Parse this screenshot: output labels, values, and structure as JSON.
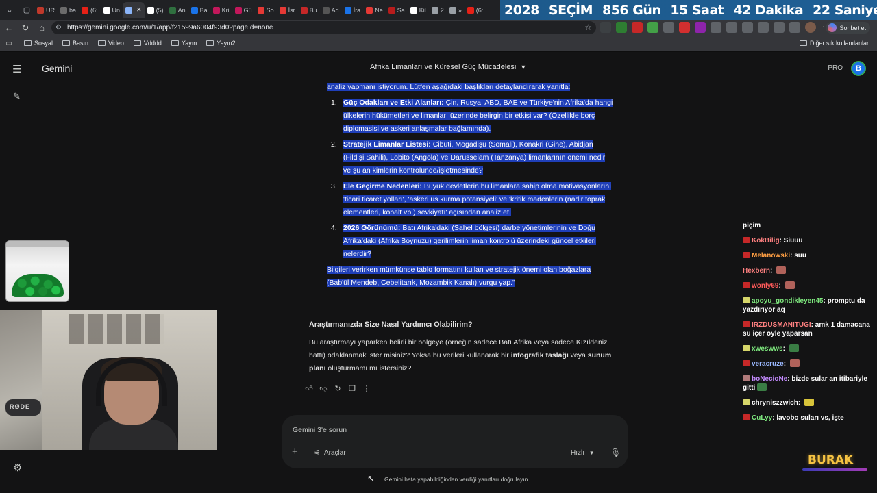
{
  "tabs": [
    {
      "label": "UR",
      "color": "#c0392b"
    },
    {
      "label": "ba",
      "color": "#6b6b6b"
    },
    {
      "label": "(6:",
      "color": "#e62117"
    },
    {
      "label": "Un",
      "color": "#ffffff"
    },
    {
      "label": "",
      "color": "#8ab4f8",
      "active": true
    },
    {
      "label": "(5)",
      "color": "#ffffff"
    },
    {
      "label": "An",
      "color": "#2f6f3f"
    },
    {
      "label": "Ba",
      "color": "#1a73e8"
    },
    {
      "label": "Kri",
      "color": "#c2185b"
    },
    {
      "label": "Gü",
      "color": "#c2185b"
    },
    {
      "label": "So",
      "color": "#e53935"
    },
    {
      "label": "İsr",
      "color": "#e53935"
    },
    {
      "label": "Bu",
      "color": "#c62828"
    },
    {
      "label": "Ad",
      "color": "#555555"
    },
    {
      "label": "İra",
      "color": "#1a73e8"
    },
    {
      "label": "Ne",
      "color": "#e53935"
    },
    {
      "label": "Sa",
      "color": "#b71c1c"
    },
    {
      "label": "Kil",
      "color": "#ffffff"
    },
    {
      "label": "2",
      "color": "#9aa0a6"
    },
    {
      "label": "»",
      "color": "#9aa0a6"
    },
    {
      "label": "(6:",
      "color": "#e62117"
    }
  ],
  "countdown": {
    "year": "2028",
    "label": "SEÇİM",
    "days": "856 Gün",
    "hours": "15 Saat",
    "minutes": "42 Dakika",
    "seconds": "22 Saniye"
  },
  "address": {
    "url": "https://gemini.google.com/u/1/app/f21599a6004f93d0?pageId=none",
    "sohbet_label": "Sohbet et"
  },
  "bookmarks": {
    "items": [
      "Sosyal",
      "Basın",
      "Video",
      "Vdddd",
      "Yayın",
      "Yayın2"
    ],
    "other": "Diğer sık kullanılanlar"
  },
  "header": {
    "brand": "Gemini",
    "conversation_title": "Afrika Limanları ve Küresel Güç Mücadelesi",
    "pro": "PRO",
    "avatar_letter": "B"
  },
  "prompt": {
    "intro": "analiz yapmanı istiyorum. Lütfen aşağıdaki başlıkları detaylandırarak yanıtla:",
    "items": [
      {
        "num": "1.",
        "title": "Güç Odakları ve Etki Alanları:",
        "text": " Çin, Rusya, ABD, BAE ve Türkiye'nin Afrika'da hangi ülkelerin hükümetleri ve limanları üzerinde belirgin bir etkisi var? (Özellikle borç diplomasisi ve askeri anlaşmalar bağlamında)."
      },
      {
        "num": "2.",
        "title": "Stratejik Limanlar Listesi:",
        "text": " Cibuti, Mogadişu (Somali), Konakri (Gine), Abidjan (Fildişi Sahili), Lobito (Angola) ve Darüsselam (Tanzanya) limanlarının önemi nedir ve şu an kimlerin kontrolünde/işletmesinde?"
      },
      {
        "num": "3.",
        "title": "Ele Geçirme Nedenleri:",
        "text": " Büyük devletlerin bu limanlara sahip olma motivasyonlarını 'ticari ticaret yolları', 'askeri üs kurma potansiyeli' ve 'kritik madenlerin (nadir toprak elementleri, kobalt vb.) sevkiyatı' açısından analiz et."
      },
      {
        "num": "4.",
        "title": "2026 Görünümü:",
        "text": " Batı Afrika'daki (Sahel bölgesi) darbe yönetimlerinin ve Doğu Afrika'daki (Afrika Boynuzu) gerilimlerin liman kontrolü üzerindeki güncel etkileri nelerdir?"
      }
    ],
    "outro": "Bilgileri verirken mümkünse tablo formatını kullan ve stratejik önemi olan boğazlara (Bab'ül Mendeb, Cebelitarık, Mozambik Kanalı) vurgu yap.\""
  },
  "response": {
    "heading": "Araştırmanızda Size Nasıl Yardımcı Olabilirim?",
    "text_1": "Bu araştırmayı yaparken belirli bir bölgeye (örneğin sadece Batı Afrika veya sadece Kızıldeniz hattı) odaklanmak ister misiniz? Yoksa bu verileri kullanarak bir ",
    "bold_1": "infografik taslağı",
    "text_2": " veya ",
    "bold_2": "sunum planı",
    "text_3": " oluşturmamı mı istersiniz?"
  },
  "input": {
    "placeholder": "Gemini 3'e sorun",
    "tools_label": "Araçlar",
    "speed_label": "Hızlı",
    "disclaimer": "Gemini hata yapabildiğinden verdiği yanıtları doğrulayın."
  },
  "chat": {
    "header": "piçim",
    "messages": [
      {
        "user": "KokBilig",
        "color": "#ff8080",
        "text": "Siuuu",
        "badge": "#c62828"
      },
      {
        "user": "Melanowski",
        "color": "#ff9f43",
        "text": "suu",
        "badge": "#c62828"
      },
      {
        "user": "Hexbern",
        "color": "#ff8080",
        "text": "",
        "badge": "",
        "emote": "#b0625a"
      },
      {
        "user": "wonly69",
        "color": "#ff5a5a",
        "text": "",
        "badge": "#c62828",
        "emote": "#b0625a"
      },
      {
        "user": "apoyu_gondikleyen45",
        "color": "#7ee87e",
        "text": "promptu da yazdırıyor aq",
        "badge": "#d6d66a"
      },
      {
        "user": "IRZDUSMANITUGI",
        "color": "#ff8080",
        "text": "amk 1 damacana su içer öyle yaparsan",
        "badge": "#c62828"
      },
      {
        "user": "xweswws",
        "color": "#7ee87e",
        "text": "",
        "badge": "#d6d66a",
        "emote": "#3a7d44"
      },
      {
        "user": "veracruze",
        "color": "#9ab8ff",
        "text": "",
        "badge": "#c62828",
        "emote": "#b0625a"
      },
      {
        "user": "boNecioNe",
        "color": "#c48bff",
        "text": "bizde sular an itibariyle gitti",
        "badge": "#b07a7a",
        "emote": "#3a7d44"
      },
      {
        "user": "chryniszzwich",
        "color": "#ffffff",
        "text": "",
        "badge": "#d6d66a",
        "emote": "#d8c43a"
      },
      {
        "user": "CuLyy",
        "color": "#7ee87e",
        "text": "lavobo suları vs, işte",
        "badge": "#c62828"
      }
    ]
  },
  "overlay": {
    "mic_brand": "RØDE",
    "streamer_name": "BURAK"
  }
}
